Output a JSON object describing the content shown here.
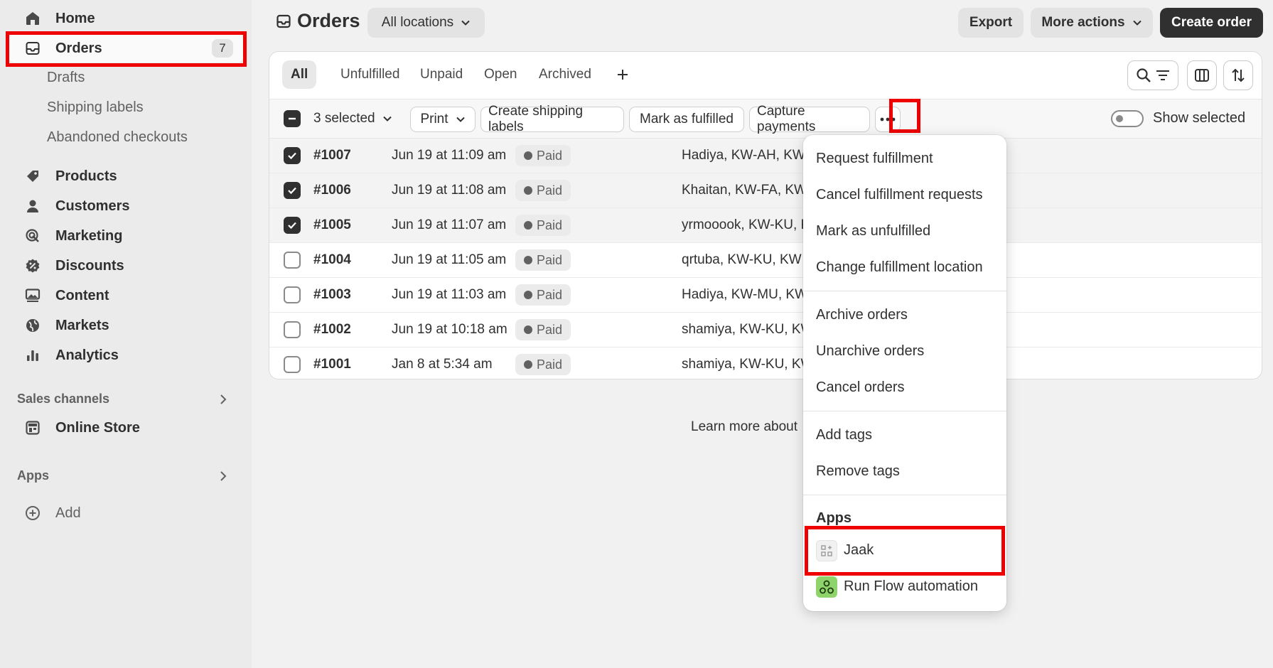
{
  "sidebar": {
    "home": "Home",
    "orders": "Orders",
    "orders_count": "7",
    "drafts": "Drafts",
    "shipping_labels": "Shipping labels",
    "abandoned": "Abandoned checkouts",
    "products": "Products",
    "customers": "Customers",
    "marketing": "Marketing",
    "discounts": "Discounts",
    "content": "Content",
    "markets": "Markets",
    "analytics": "Analytics",
    "sales_channels": "Sales channels",
    "online_store": "Online Store",
    "apps": "Apps",
    "add": "Add"
  },
  "header": {
    "title": "Orders",
    "locations": "All locations",
    "export": "Export",
    "more_actions": "More actions",
    "create_order": "Create order"
  },
  "tabs": [
    "All",
    "Unfulfilled",
    "Unpaid",
    "Open",
    "Archived"
  ],
  "bulk": {
    "selected": "3 selected",
    "print": "Print",
    "create_labels": "Create shipping labels",
    "mark_fulfilled": "Mark as fulfilled",
    "capture": "Capture payments",
    "show_selected": "Show selected"
  },
  "orders": [
    {
      "id": "#1007",
      "date": "Jun 19 at 11:09 am",
      "payment": "Paid",
      "dest": "Hadiya, KW-AH, KW",
      "selected": true
    },
    {
      "id": "#1006",
      "date": "Jun 19 at 11:08 am",
      "payment": "Paid",
      "dest": "Khaitan, KW-FA, KW",
      "selected": true
    },
    {
      "id": "#1005",
      "date": "Jun 19 at 11:07 am",
      "payment": "Paid",
      "dest": "yrmooook, KW-KU, KW",
      "selected": true
    },
    {
      "id": "#1004",
      "date": "Jun 19 at 11:05 am",
      "payment": "Paid",
      "dest": "qrtuba, KW-KU, KW",
      "selected": false
    },
    {
      "id": "#1003",
      "date": "Jun 19 at 11:03 am",
      "payment": "Paid",
      "dest": "Hadiya, KW-MU, KW",
      "selected": false
    },
    {
      "id": "#1002",
      "date": "Jun 19 at 10:18 am",
      "payment": "Paid",
      "dest": "shamiya, KW-KU, KW",
      "selected": false
    },
    {
      "id": "#1001",
      "date": "Jan 8 at 5:34 am",
      "payment": "Paid",
      "dest": "shamiya, KW-KU, KW",
      "selected": false
    }
  ],
  "footer": {
    "learn_more": "Learn more about"
  },
  "menu": {
    "request_fulfillment": "Request fulfillment",
    "cancel_fulfillment_requests": "Cancel fulfillment requests",
    "mark_unfulfilled": "Mark as unfulfilled",
    "change_location": "Change fulfillment location",
    "archive": "Archive orders",
    "unarchive": "Unarchive orders",
    "cancel": "Cancel orders",
    "add_tags": "Add tags",
    "remove_tags": "Remove tags",
    "apps_heading": "Apps",
    "jaak": "Jaak",
    "run_flow": "Run Flow automation"
  },
  "colors": {
    "annotation": "#ee0000",
    "dark_button": "#303030",
    "sidebar_bg": "#ebebeb"
  }
}
